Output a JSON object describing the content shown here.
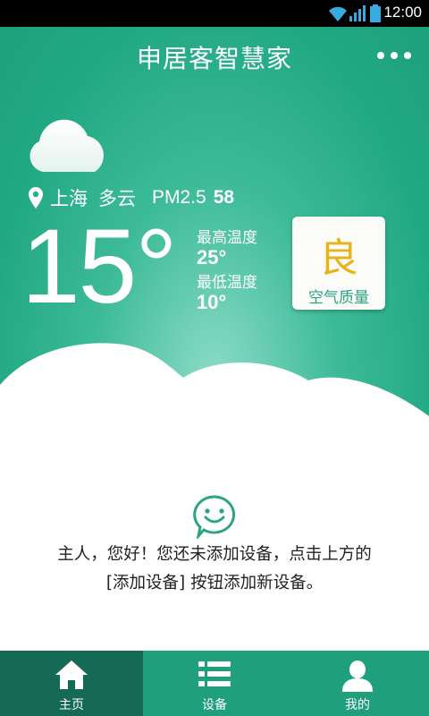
{
  "status_bar": {
    "time": "12:00"
  },
  "header": {
    "title": "申居客智慧家"
  },
  "weather": {
    "city": "上海",
    "condition": "多云",
    "pm_label": "PM2.5",
    "pm_value": "58",
    "temperature": "15°",
    "high_label": "最高温度",
    "high_value": "25°",
    "low_label": "最低温度",
    "low_value": "10°"
  },
  "air_quality": {
    "grade": "良",
    "label": "空气质量",
    "grade_color": "#e8b31a"
  },
  "empty_state": {
    "line1": "主人，您好！您还未添加设备，点击上方的",
    "line2": "[添加设备] 按钮添加新设备。"
  },
  "tabs": [
    {
      "label": "主页",
      "icon": "home-icon",
      "active": true
    },
    {
      "label": "设备",
      "icon": "list-icon",
      "active": false
    },
    {
      "label": "我的",
      "icon": "user-icon",
      "active": false
    }
  ],
  "colors": {
    "brand": "#21a882",
    "tab_bar": "#1f9f7c",
    "tab_active": "#146a55"
  }
}
